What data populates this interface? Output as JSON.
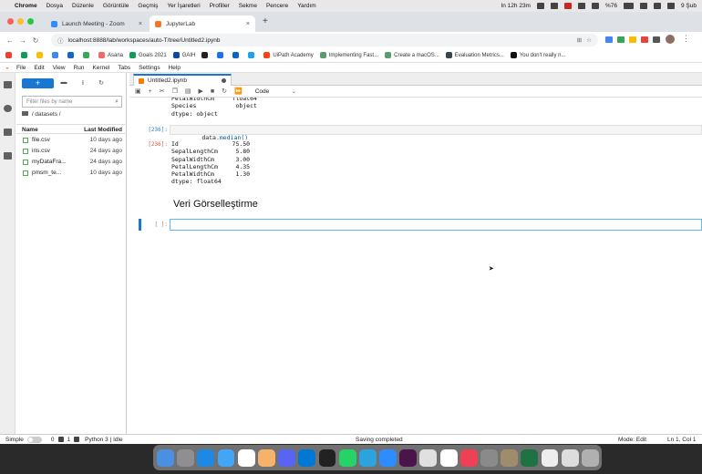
{
  "macbar": {
    "apple": "",
    "app": "Chrome",
    "menus": [
      "Dosya",
      "Düzenle",
      "Görüntüle",
      "Geçmiş",
      "Yer İşaretleri",
      "Profiller",
      "Sekme",
      "Pencere",
      "Yardım"
    ],
    "time_remaining": "In 12h 23m",
    "battery": "%76",
    "date": "9 Şub"
  },
  "chrome": {
    "tabs": [
      {
        "title": "Launch Meeting - Zoom",
        "favicon_color": "#2d8cff"
      },
      {
        "title": "JupyterLab",
        "favicon_color": "#f37726"
      }
    ],
    "new_tab": "+",
    "url": "localhost:8888/lab/workspaces/auto-T/tree/Untitled2.ipynb",
    "bookmarks": [
      {
        "label": "",
        "color": "#ea4335"
      },
      {
        "label": "",
        "color": "#0f9d58"
      },
      {
        "label": "",
        "color": "#fbbc04"
      },
      {
        "label": "",
        "color": "#4285f4"
      },
      {
        "label": "",
        "color": "#1565c0"
      },
      {
        "label": "",
        "color": "#34a853"
      },
      {
        "label": "Asana",
        "color": "#f06a6a"
      },
      {
        "label": "Goals 2021",
        "color": "#0f9d58"
      },
      {
        "label": "GAIH",
        "color": "#0d47a1"
      },
      {
        "label": "",
        "color": "#222222"
      },
      {
        "label": "",
        "color": "#1a73e8"
      },
      {
        "label": "",
        "color": "#0a66c2"
      },
      {
        "label": "",
        "color": "#1da1f2"
      },
      {
        "label": "UiPath Academy",
        "color": "#fa4616"
      },
      {
        "label": "Implementing Fast...",
        "color": "#5a9e6f"
      },
      {
        "label": "Create a macOS...",
        "color": "#5a9e6f"
      },
      {
        "label": "Evaluation Metrics...",
        "color": "#37474f"
      },
      {
        "label": "You don't really n...",
        "color": "#111111"
      }
    ]
  },
  "jupyter": {
    "menus": [
      "File",
      "Edit",
      "View",
      "Run",
      "Kernel",
      "Tabs",
      "Settings",
      "Help"
    ],
    "filebrowser": {
      "new_label": "+",
      "filter_placeholder": "Filter files by name",
      "breadcrumb": "/ datasets /",
      "col_name": "Name",
      "col_modified": "Last Modified",
      "files": [
        {
          "name": "file.csv",
          "modified": "10 days ago"
        },
        {
          "name": "iris.csv",
          "modified": "24 days ago"
        },
        {
          "name": "myDataFra...",
          "modified": "24 days ago"
        },
        {
          "name": "pmsm_te...",
          "modified": "10 days ago"
        }
      ]
    },
    "notebook": {
      "tab_title": "Untitled2.ipynb",
      "cell_type": "Code",
      "prev_output": "PetalWidthCm     float64\nSpecies           object\ndtype: object",
      "in_prompt": "[236]:",
      "in_code_obj": "data",
      "in_code_method": ".median()",
      "out_prompt": "[236]:",
      "out_text": "Id               75.50\nSepalLengthCm     5.80\nSepalWidthCm      3.00\nPetalLengthCm     4.35\nPetalWidthCm      1.30\ndtype: float64",
      "markdown_heading": "Veri Görselleştirme",
      "empty_prompt": "[ ]:"
    },
    "status": {
      "mode_label": "Simple",
      "counts_a": "0",
      "counts_b": "1",
      "kernel": "Python 3 | Idle",
      "message": "Saving completed",
      "mode": "Mode: Edit",
      "cursor": "Ln 1, Col 1"
    }
  },
  "dock": {
    "apps": [
      {
        "name": "finder",
        "color": "#4a90e2"
      },
      {
        "name": "launchpad",
        "color": "#8e8e93"
      },
      {
        "name": "safari",
        "color": "#1e88e5"
      },
      {
        "name": "mail",
        "color": "#42a5f5"
      },
      {
        "name": "calendar",
        "color": "#ffffff"
      },
      {
        "name": "photos",
        "color": "#f6b26b"
      },
      {
        "name": "discord",
        "color": "#5865f2"
      },
      {
        "name": "vscode",
        "color": "#0078d4"
      },
      {
        "name": "terminal",
        "color": "#222222"
      },
      {
        "name": "whatsapp",
        "color": "#25d366"
      },
      {
        "name": "telegram",
        "color": "#2aa3df"
      },
      {
        "name": "zoom",
        "color": "#2d8cff"
      },
      {
        "name": "slack",
        "color": "#4a154b"
      },
      {
        "name": "chrome",
        "color": "#e0e0e0"
      },
      {
        "name": "notion",
        "color": "#ffffff"
      },
      {
        "name": "pocket",
        "color": "#ef4056"
      },
      {
        "name": "system-prefs",
        "color": "#8a8a8a"
      },
      {
        "name": "preview",
        "color": "#9e8c6c"
      },
      {
        "name": "excel",
        "color": "#1f7244"
      },
      {
        "name": "textedit",
        "color": "#eeeeee"
      },
      {
        "name": "chrome-2",
        "color": "#dddddd"
      },
      {
        "name": "trash",
        "color": "#b0b0b0"
      }
    ]
  }
}
